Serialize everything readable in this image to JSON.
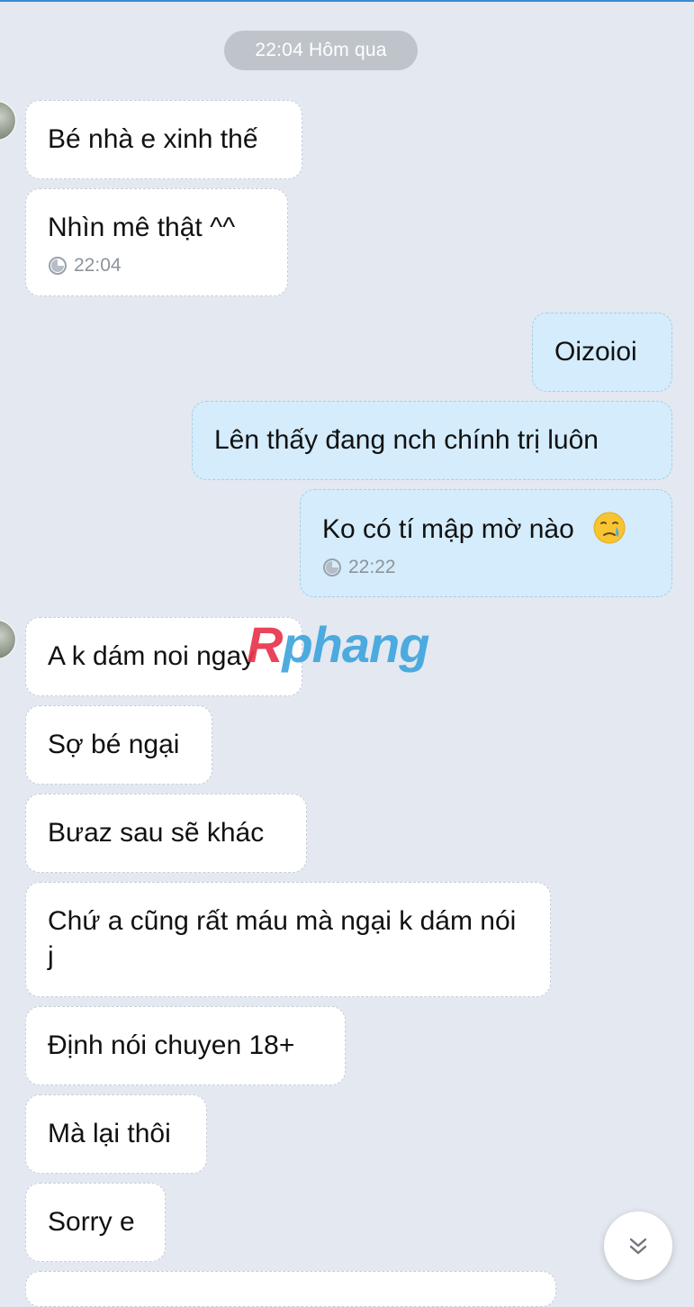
{
  "date_separator": "22:04 Hôm qua",
  "messages": [
    {
      "side": "in",
      "text": "Bé nhà e xinh thế"
    },
    {
      "side": "in",
      "text": "Nhìn mê thật ^^",
      "time": "22:04"
    },
    {
      "side": "out",
      "text": "Oizoioi"
    },
    {
      "side": "out",
      "text": "Lên thấy đang nch chính trị luôn"
    },
    {
      "side": "out",
      "text": "Ko có tí mập mờ nào",
      "emoji": "crying-face-icon",
      "time": "22:22"
    },
    {
      "side": "in",
      "text": "A k dám noi ngay"
    },
    {
      "side": "in",
      "text": "Sợ bé ngại"
    },
    {
      "side": "in",
      "text": "Bưaz sau sẽ khác"
    },
    {
      "side": "in",
      "text": "Chứ a cũng rất máu mà ngại k dám nói j"
    },
    {
      "side": "in",
      "text": "Định nói chuyen 18+"
    },
    {
      "side": "in",
      "text": "Mà lại thôi"
    },
    {
      "side": "in",
      "text": "Sorry e"
    }
  ],
  "watermark": {
    "first_letter": "R",
    "rest": "phang"
  },
  "icons": {
    "timestamp": "clock-icon",
    "scroll": "chevron-double-down-icon"
  },
  "colors": {
    "background": "#e3e8f1",
    "incoming_bubble": "#ffffff",
    "outgoing_bubble": "#d4ecfb",
    "date_pill": "#bfc4cb",
    "watermark_blue": "#3fa5dd",
    "watermark_red": "#e8354c"
  }
}
